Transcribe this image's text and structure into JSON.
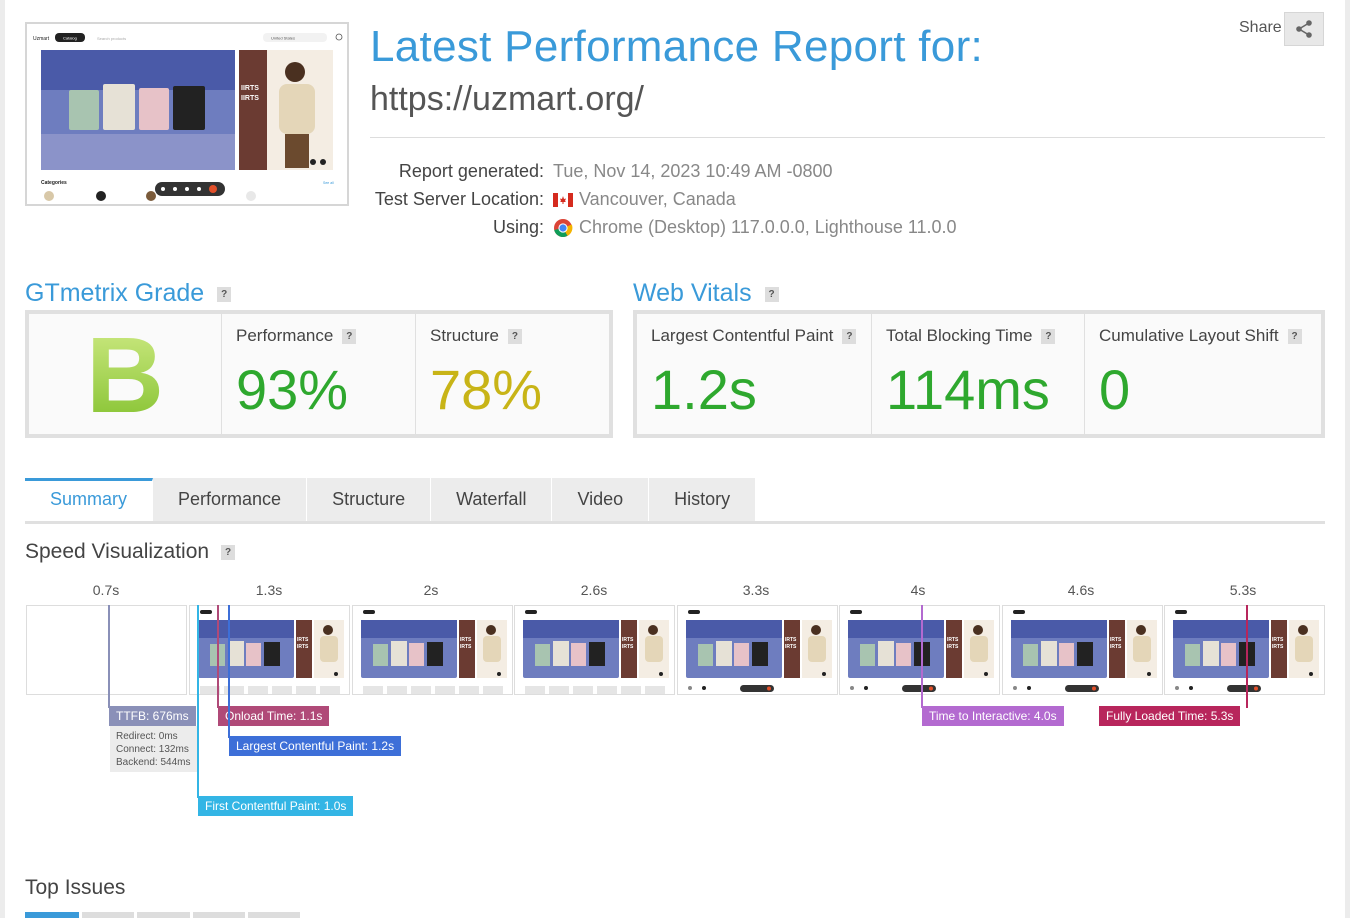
{
  "header": {
    "title": "Latest Performance Report for:",
    "url": "https://uzmart.org/",
    "share_label": "Share",
    "meta": [
      {
        "label": "Report generated:",
        "value": "Tue, Nov 14, 2023 10:49 AM -0800",
        "icon": ""
      },
      {
        "label": "Test Server Location:",
        "value": "Vancouver, Canada",
        "icon": "canada-flag-icon"
      },
      {
        "label": "Using:",
        "value": "Chrome (Desktop) 117.0.0.0, Lighthouse 11.0.0",
        "icon": "chrome-icon"
      }
    ]
  },
  "thumbnail": {
    "brand": "Uzmart",
    "catalog_label": "Catalog",
    "search_placeholder": "Search products",
    "region": "United States",
    "banner_text": "IIRTS\nIIRTS",
    "categories_label": "Categories",
    "see_all": "See all"
  },
  "grade": {
    "title": "GTmetrix Grade",
    "letter": "B",
    "performance_label": "Performance",
    "performance_value": "93%",
    "structure_label": "Structure",
    "structure_value": "78%"
  },
  "vitals": {
    "title": "Web Vitals",
    "lcp_label": "Largest Contentful Paint",
    "lcp_value": "1.2s",
    "tbt_label": "Total Blocking Time",
    "tbt_value": "114ms",
    "cls_label": "Cumulative Layout Shift",
    "cls_value": "0"
  },
  "tabs": [
    "Summary",
    "Performance",
    "Structure",
    "Waterfall",
    "Video",
    "History"
  ],
  "active_tab": "Summary",
  "speed": {
    "title": "Speed Visualization",
    "times": [
      "0.7s",
      "1.3s",
      "2s",
      "2.6s",
      "3.3s",
      "4s",
      "4.6s",
      "5.3s"
    ],
    "markers": {
      "ttfb": "TTFB: 676ms",
      "ttfb_redirect": "Redirect: 0ms",
      "ttfb_connect": "Connect: 132ms",
      "ttfb_backend": "Backend: 544ms",
      "onload": "Onload Time: 1.1s",
      "lcp": "Largest Contentful Paint: 1.2s",
      "fcp": "First Contentful Paint: 1.0s",
      "tti": "Time to Interactive: 4.0s",
      "fully_loaded": "Fully Loaded Time: 5.3s"
    },
    "colors": {
      "ttfb": "#8a90b8",
      "onload": "#b04a78",
      "lcp": "#3d6fd8",
      "fcp": "#33b5e5",
      "tti": "#b36ad0",
      "fully_loaded": "#b8265c"
    }
  },
  "top_issues": {
    "title": "Top Issues"
  }
}
